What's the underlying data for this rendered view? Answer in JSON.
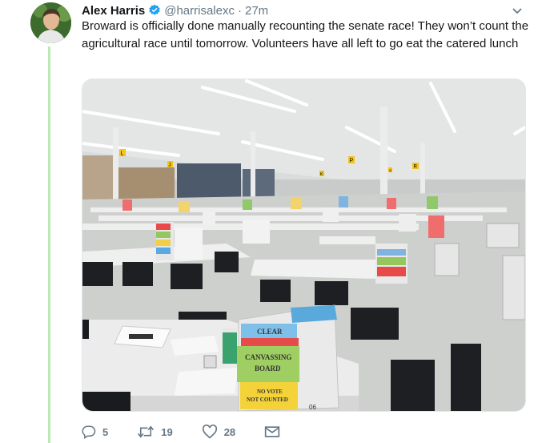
{
  "tweet": {
    "author_name": "Alex Harris",
    "handle": "@harrisalexc",
    "separator": "·",
    "time": "27m",
    "text": "Broward is officially done manually recounting the senate race! They won’t count the agricultural race until tomorrow. Volunteers have all left to go eat the catered lunch"
  },
  "photo": {
    "sign_clear": "CLEAR",
    "sign_canvassing": "CANVASSING",
    "sign_board": "BOARD",
    "sign_no_vote": "NO VOTE",
    "sign_not_counted": "NOT COUNTED",
    "box_number": "06",
    "pillar_letters": [
      "L",
      "J",
      "K",
      "P",
      "Q",
      "R"
    ]
  },
  "actions": {
    "reply_count": "5",
    "retweet_count": "19",
    "like_count": "28"
  },
  "colors": {
    "thread_line": "#b8eab2",
    "verified": "#1da1f2",
    "muted": "#657786"
  }
}
